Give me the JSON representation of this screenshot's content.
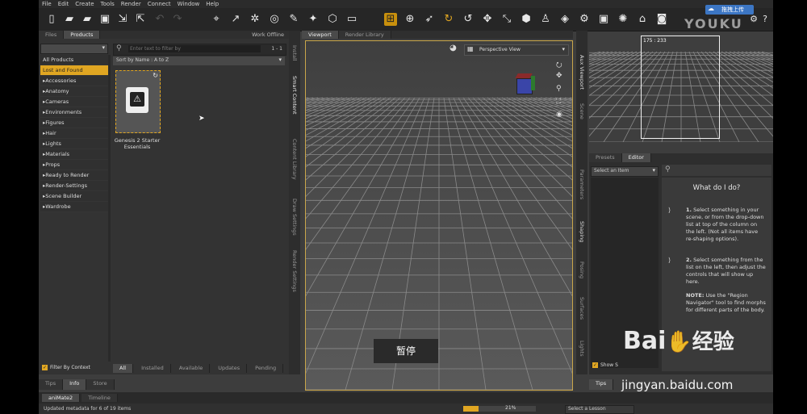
{
  "menu": [
    "File",
    "Edit",
    "Create",
    "Tools",
    "Render",
    "Connect",
    "Window",
    "Help"
  ],
  "watermark_upload": "拖拽上传",
  "watermark_youku": "YOUKU",
  "left_panel": {
    "tabs": [
      "Files",
      "Products"
    ],
    "work_offline": "Work Offline",
    "filter_placeholder": "Enter text to filter by",
    "count": "1 - 1",
    "sort": "Sort by Name : A to Z",
    "categories": [
      "All Products",
      "Lost and Found",
      "Accessories",
      "Anatomy",
      "Cameras",
      "Environments",
      "Figures",
      "Hair",
      "Lights",
      "Materials",
      "Props",
      "Ready to Render",
      "Render-Settings",
      "Scene Builder",
      "Wardrobe"
    ],
    "selected_category": "Lost and Found",
    "product_name": "Genesis 2 Starter Essentials",
    "filter_context": "Filter By Context",
    "bottom_tabs": [
      "All",
      "Installed",
      "Available",
      "Updates",
      "Pending"
    ],
    "side_tabs": [
      "Install",
      "Smart Content",
      "Content Library",
      "Draw Settings",
      "Render Settings"
    ]
  },
  "bottom_left_tabs": [
    "Tips",
    "Info",
    "Store"
  ],
  "viewport": {
    "tabs": [
      "Viewport",
      "Render Library"
    ],
    "view": "Perspective View",
    "pause_label": "暂停"
  },
  "aux_viewport": {
    "side_tabs": [
      "Aux Viewport",
      "Scene"
    ],
    "dims": "175 : 233"
  },
  "right_panel": {
    "tabs": [
      "Presets",
      "Editor"
    ],
    "select_item": "Select an Item",
    "side_tabs": [
      "Parameters",
      "Shaping",
      "Posing",
      "Surfaces",
      "Lights"
    ],
    "help_title": "What do I do?",
    "step1_num": "1.",
    "step1": "Select something in your scene, or from the drop-down list at top of the column on the left. (Not all items have re-shaping options).",
    "step2_num": "2.",
    "step2": "Select something from the list on the left, then adjust the controls that will show up here.",
    "note_label": "NOTE:",
    "note": "Use the \"Region Navigator\" tool to find morphs for different parts of the body.",
    "show_sub": "Show S"
  },
  "bottom_right_tabs": [
    "Tips"
  ],
  "timeline_tabs": [
    "aniMate2",
    "Timeline"
  ],
  "status": "Updated metadata for 6 of 19 items",
  "progress_pct": "21%",
  "progress_value": 0.21,
  "lesson_select": "Select a Lesson",
  "baidu": {
    "brand": "Bai",
    "brand2": "经验",
    "url": "jingyan.baidu.com"
  }
}
